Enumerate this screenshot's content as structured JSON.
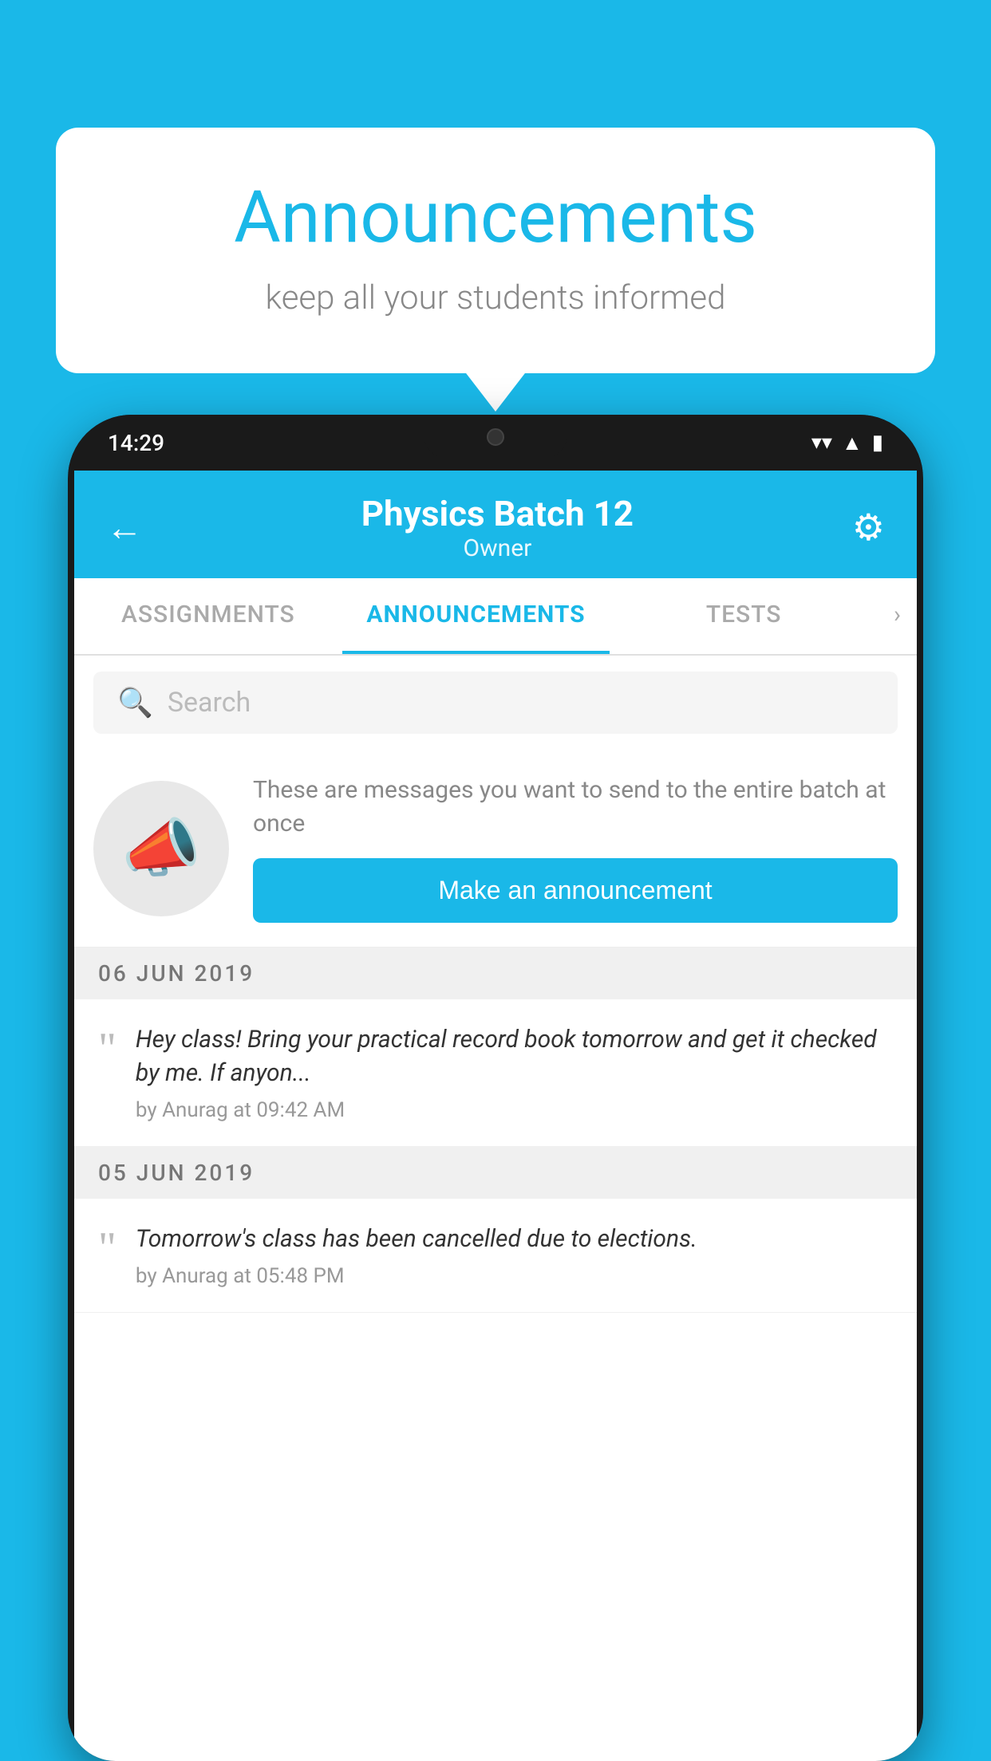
{
  "background_color": "#1ab8e8",
  "speech_bubble": {
    "title": "Announcements",
    "subtitle": "keep all your students informed"
  },
  "phone": {
    "status_bar": {
      "time": "14:29"
    },
    "header": {
      "title": "Physics Batch 12",
      "subtitle": "Owner",
      "back_label": "←",
      "settings_label": "⚙"
    },
    "tabs": [
      {
        "label": "ASSIGNMENTS",
        "active": false
      },
      {
        "label": "ANNOUNCEMENTS",
        "active": true
      },
      {
        "label": "TESTS",
        "active": false
      }
    ],
    "search": {
      "placeholder": "Search"
    },
    "promo": {
      "description": "These are messages you want to send to the entire batch at once",
      "button_label": "Make an announcement"
    },
    "announcements": [
      {
        "date": "06  JUN  2019",
        "text": "Hey class! Bring your practical record book tomorrow and get it checked by me. If anyon...",
        "meta": "by Anurag at 09:42 AM"
      },
      {
        "date": "05  JUN  2019",
        "text": "Tomorrow's class has been cancelled due to elections.",
        "meta": "by Anurag at 05:48 PM"
      }
    ]
  }
}
